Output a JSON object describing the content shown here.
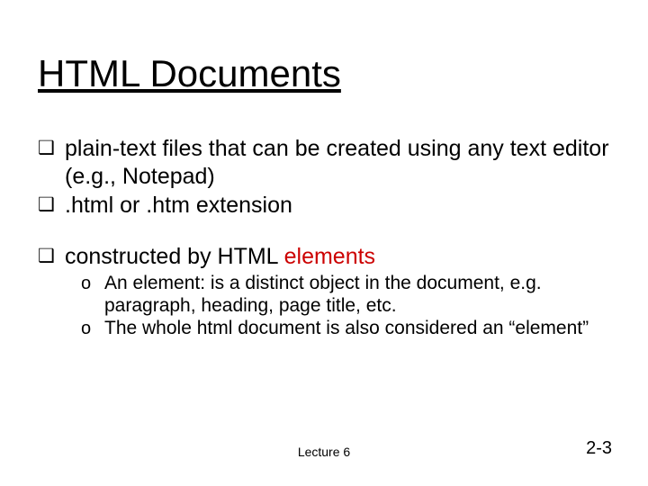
{
  "title": "HTML Documents",
  "bullets": [
    {
      "marker": "❑",
      "text": "plain-text files that can be created using any text editor (e.g., Notepad)"
    },
    {
      "marker": "❑",
      "text": ".html or .htm extension"
    },
    {
      "marker": "❑",
      "text_prefix": "constructed by HTML ",
      "text_red": "elements",
      "sub": [
        {
          "marker": "o",
          "text": "An element: is a distinct object in the document, e.g. paragraph, heading, page title, etc."
        },
        {
          "marker": "o",
          "text": "The whole html document is also considered an “element”"
        }
      ]
    }
  ],
  "footer": "Lecture 6",
  "page_number": "2-3"
}
